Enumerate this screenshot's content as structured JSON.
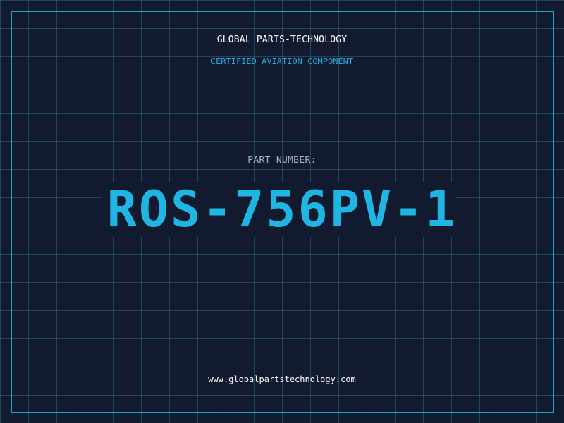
{
  "header": {
    "brand": "GLOBAL PARTS-TECHNOLOGY",
    "subtitle": "CERTIFIED AVIATION COMPONENT"
  },
  "part": {
    "label": "PART NUMBER:",
    "number": "ROS-756PV-1"
  },
  "footer": {
    "website": "www.globalpartstechnology.com"
  },
  "colors": {
    "background": "#111a2e",
    "grid": "#266e82",
    "accent": "#1fb6e3",
    "border": "#1ea2c8",
    "text": "#ffffff",
    "label": "#a7b3c2"
  }
}
